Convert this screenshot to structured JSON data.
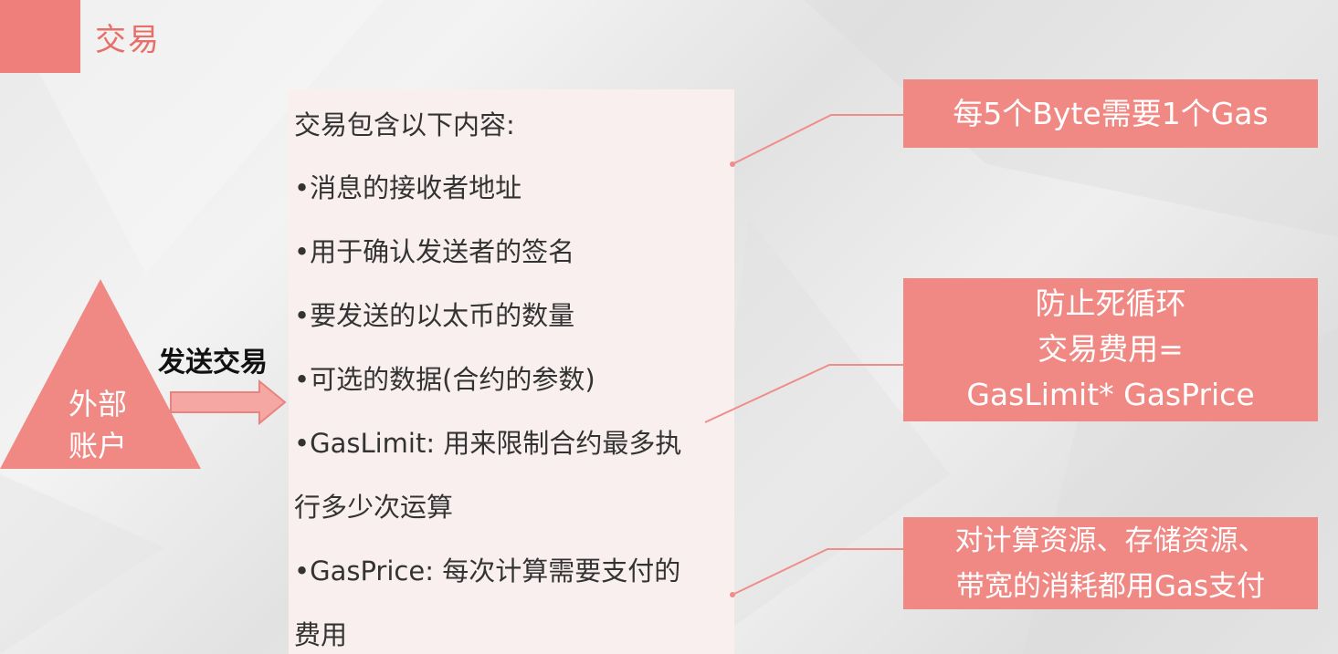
{
  "title": "交易",
  "actor": {
    "line1": "外部",
    "line2": "账户"
  },
  "send_label": "发送交易",
  "panel": {
    "heading": "交易包含以下内容:",
    "items": [
      "•消息的接收者地址",
      "•用于确认发送者的签名",
      "•要发送的以太币的数量",
      "•可选的数据(合约的参数)",
      "•GasLimit: 用来限制合约最多执",
      "行多少次运算",
      "•GasPrice: 每次计算需要支付的",
      "费用"
    ]
  },
  "callouts": {
    "byte_gas": "每5个Byte需要1个Gas",
    "loop": {
      "line1": "防止死循环",
      "line2": "交易费用=",
      "line3": "GasLimit* GasPrice"
    },
    "resources": {
      "line1": "对计算资源、存储资源、",
      "line2": "带宽的消耗都用Gas支付"
    }
  },
  "colors": {
    "accent": "#ee7f7a",
    "callout": "#f08884",
    "panel": "#f8efee"
  }
}
